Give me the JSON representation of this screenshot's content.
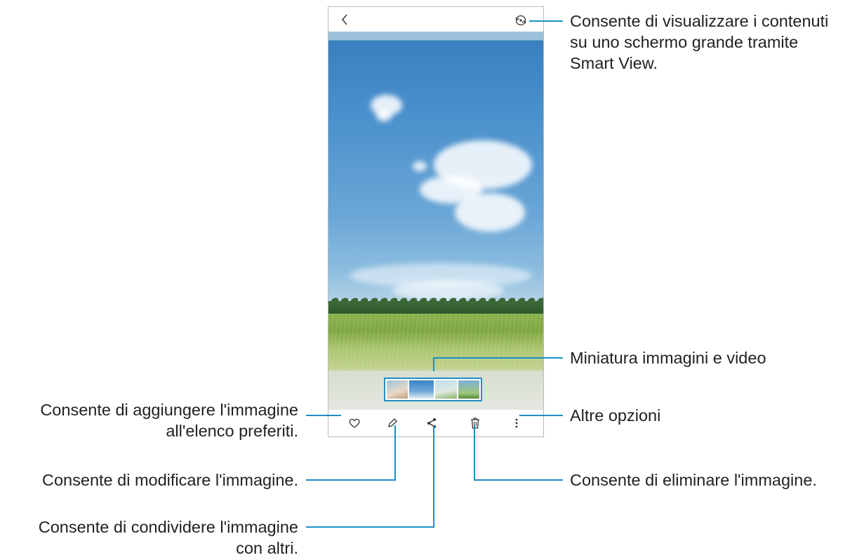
{
  "annotations": {
    "smart_view": [
      "Consente di visualizzare i contenuti",
      "su uno schermo grande tramite",
      "Smart View."
    ],
    "thumbnails": "Miniatura immagini e video",
    "favorite": [
      "Consente di aggiungere l'immagine",
      "all'elenco preferiti."
    ],
    "more_options": "Altre opzioni",
    "edit": "Consente di modificare l'immagine.",
    "delete": "Consente di eliminare l'immagine.",
    "share": [
      "Consente di condividere l'immagine",
      "con altri."
    ]
  },
  "icons": {
    "back": "chevron-left-icon",
    "smart_view": "smart-view-icon",
    "favorite": "heart-icon",
    "edit": "pencil-icon",
    "share": "share-icon",
    "delete": "trash-icon",
    "more": "more-vertical-icon"
  },
  "colors": {
    "accent": "#1c8fc8",
    "text": "#231f20"
  }
}
